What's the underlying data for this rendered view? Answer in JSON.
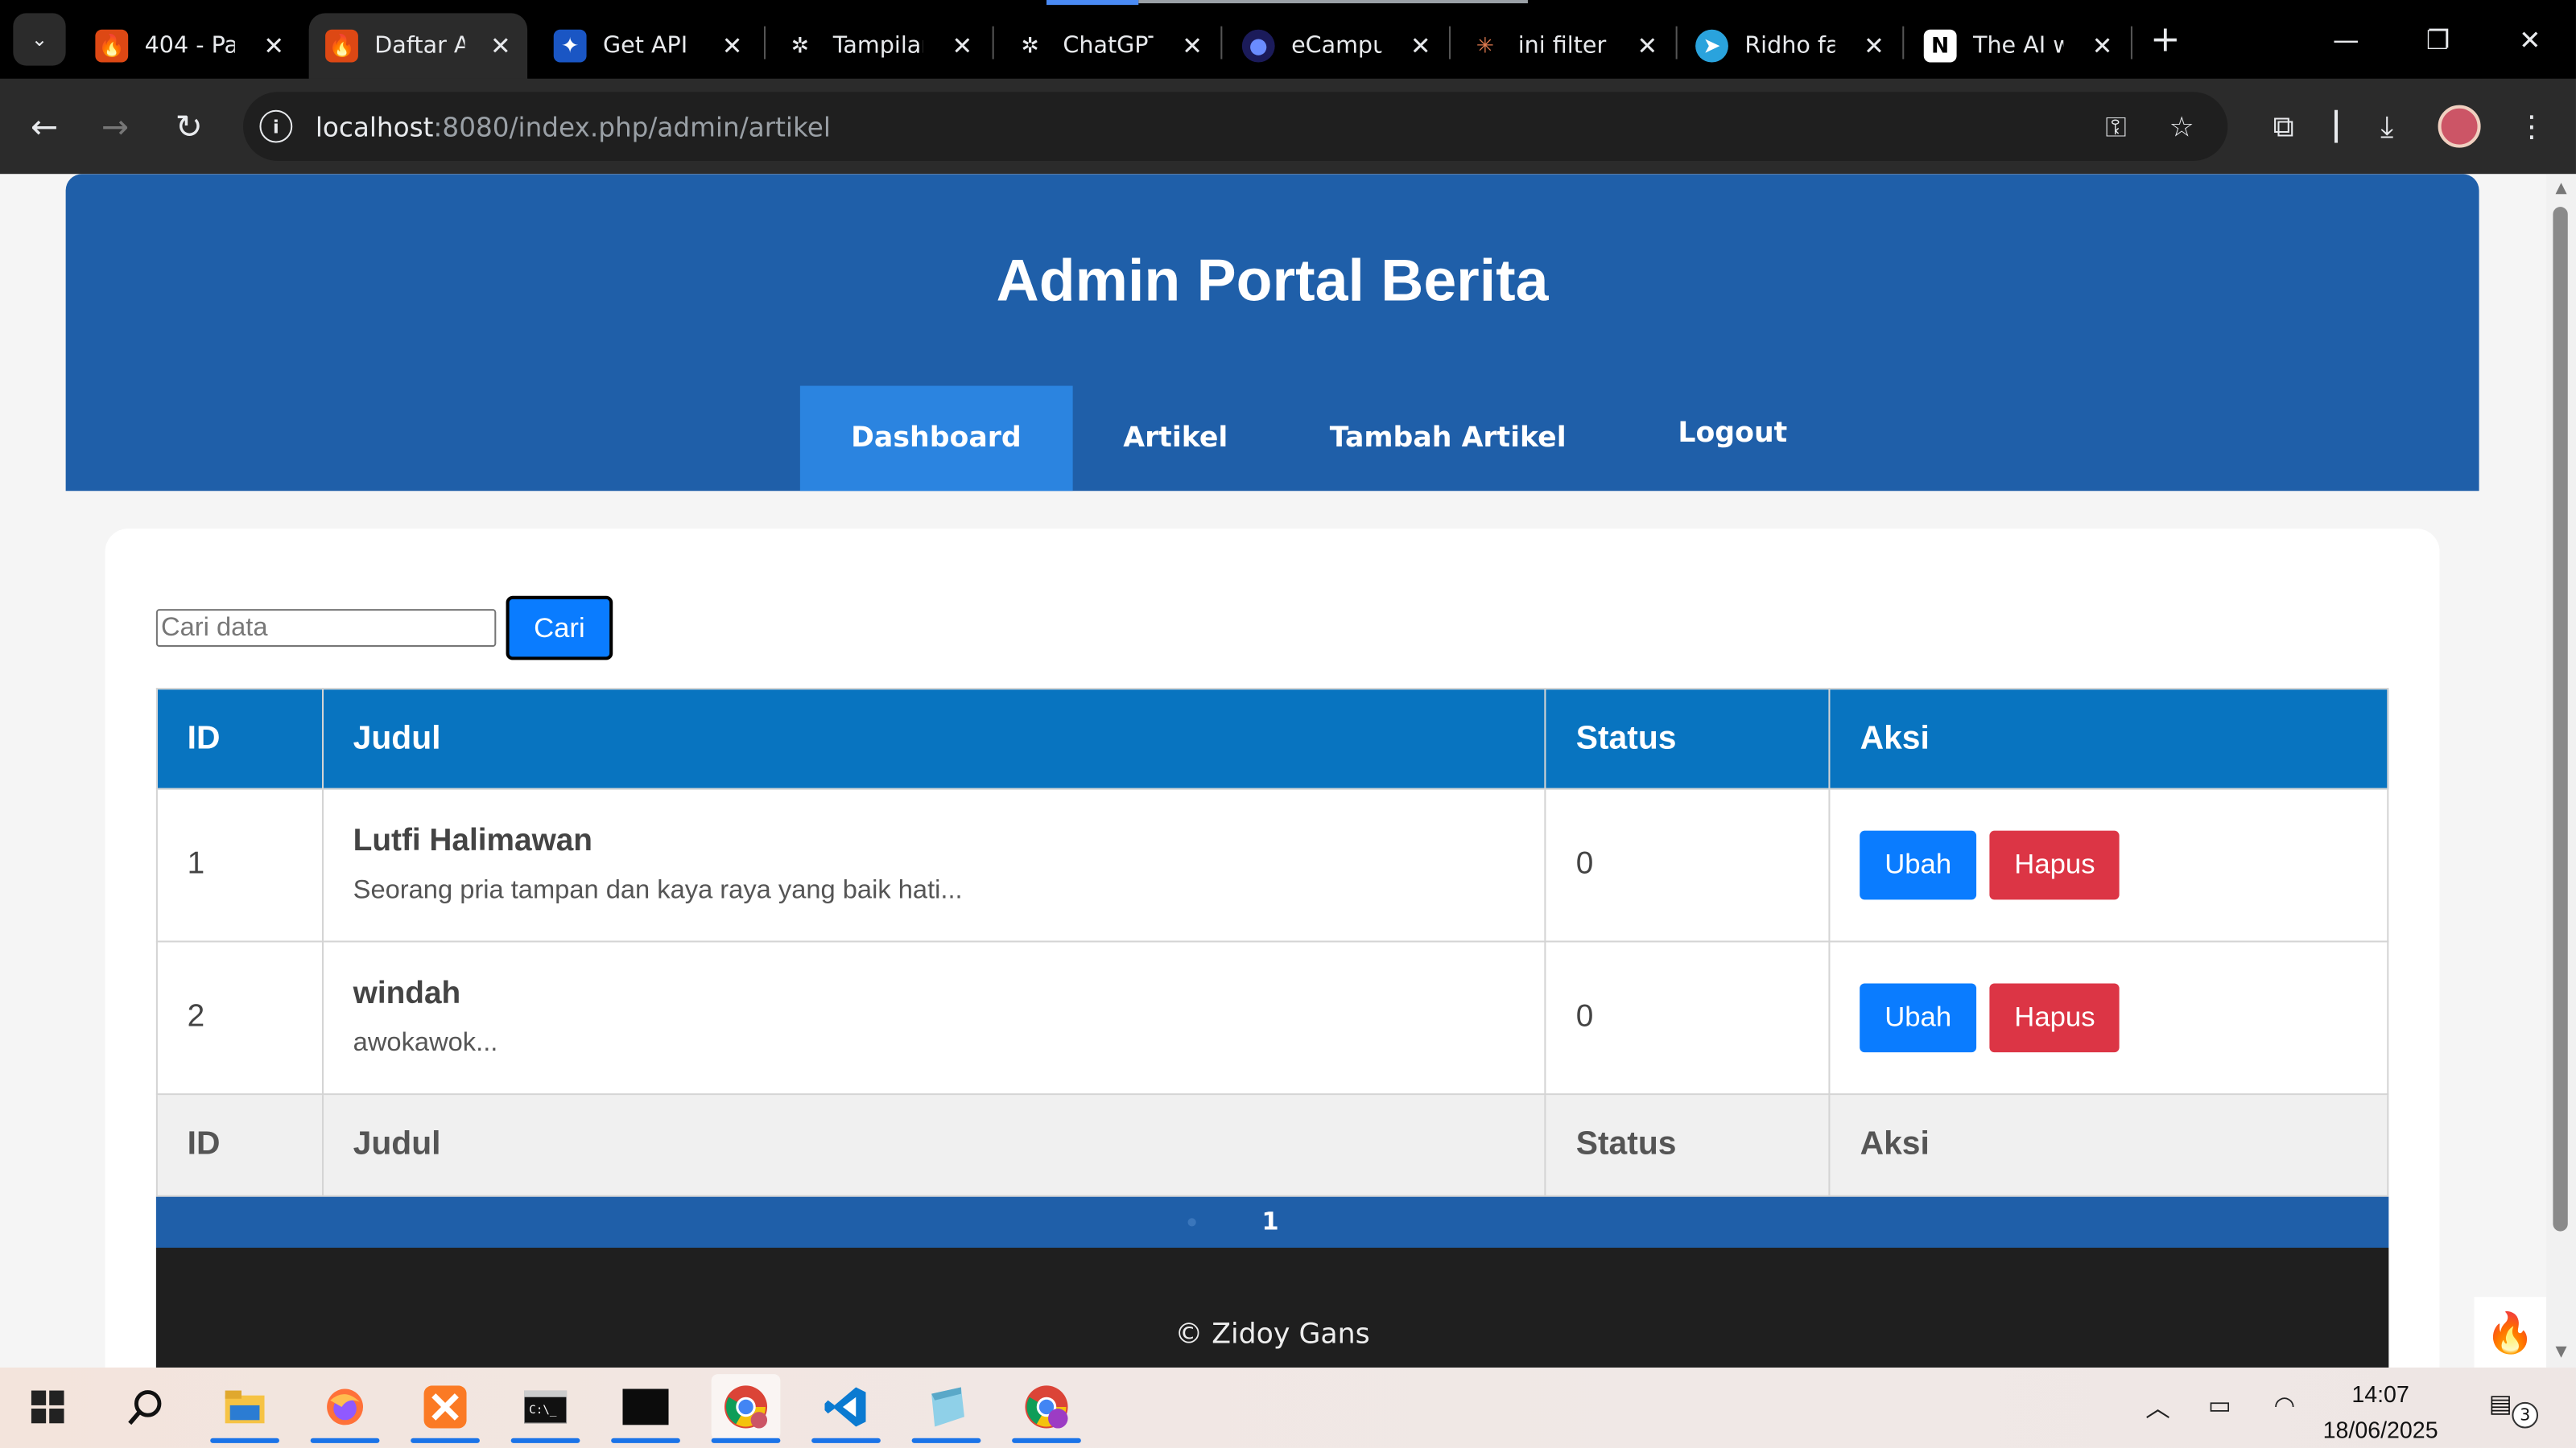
{
  "browser": {
    "tabs": [
      {
        "title": "404 - Pa",
        "icon": "codeigniter-icon",
        "active": false
      },
      {
        "title": "Daftar A",
        "icon": "codeigniter-icon",
        "active": true
      },
      {
        "title": "Get API",
        "icon": "butterfly-icon",
        "active": false
      },
      {
        "title": "Tampilan",
        "icon": "openai-icon",
        "active": false
      },
      {
        "title": "ChatGPT",
        "icon": "openai-icon",
        "active": false
      },
      {
        "title": "eCampus",
        "icon": "ecampus-icon",
        "active": false
      },
      {
        "title": "ini filter",
        "icon": "claude-icon",
        "active": false
      },
      {
        "title": "Ridho fa",
        "icon": "telegram-icon",
        "active": false
      },
      {
        "title": "The AI w",
        "icon": "notion-icon",
        "active": false
      }
    ],
    "url_host": "localhost",
    "url_path": ":8080/index.php/admin/artikel"
  },
  "page": {
    "header_title": "Admin Portal Berita",
    "nav": [
      {
        "label": "Dashboard",
        "active": true
      },
      {
        "label": "Artikel",
        "active": false
      },
      {
        "label": "Tambah Artikel",
        "active": false
      },
      {
        "label": "Logout",
        "active": false
      }
    ],
    "search": {
      "placeholder": "Cari data",
      "button": "Cari"
    },
    "table": {
      "columns": [
        "ID",
        "Judul",
        "Status",
        "Aksi"
      ],
      "rows": [
        {
          "id": "1",
          "title": "Lutfi Halimawan",
          "snippet": "Seorang pria tampan dan kaya raya yang baik hati...",
          "status": "0",
          "edit": "Ubah",
          "delete": "Hapus"
        },
        {
          "id": "2",
          "title": "windah",
          "snippet": "awokawok...",
          "status": "0",
          "edit": "Ubah",
          "delete": "Hapus"
        }
      ]
    },
    "pagination": {
      "current": "1"
    },
    "footer": "© Zidoy Gans"
  },
  "colors": {
    "header_bg": "#1f5fa9",
    "nav_active": "#2b84e0",
    "table_header": "#0874c0",
    "btn_edit": "#0a7cff",
    "btn_delete": "#dc3545",
    "footer_bg": "#1f1f1f"
  },
  "taskbar": {
    "time": "14:07",
    "date": "18/06/2025",
    "notification_count": "3",
    "apps": [
      "windows-start-icon",
      "search-icon",
      "file-explorer-icon",
      "firefox-icon",
      "xampp-icon",
      "cmd-icon",
      "terminal-icon",
      "chrome-icon",
      "vscode-icon",
      "notepad-icon",
      "chrome-profile-icon"
    ]
  }
}
